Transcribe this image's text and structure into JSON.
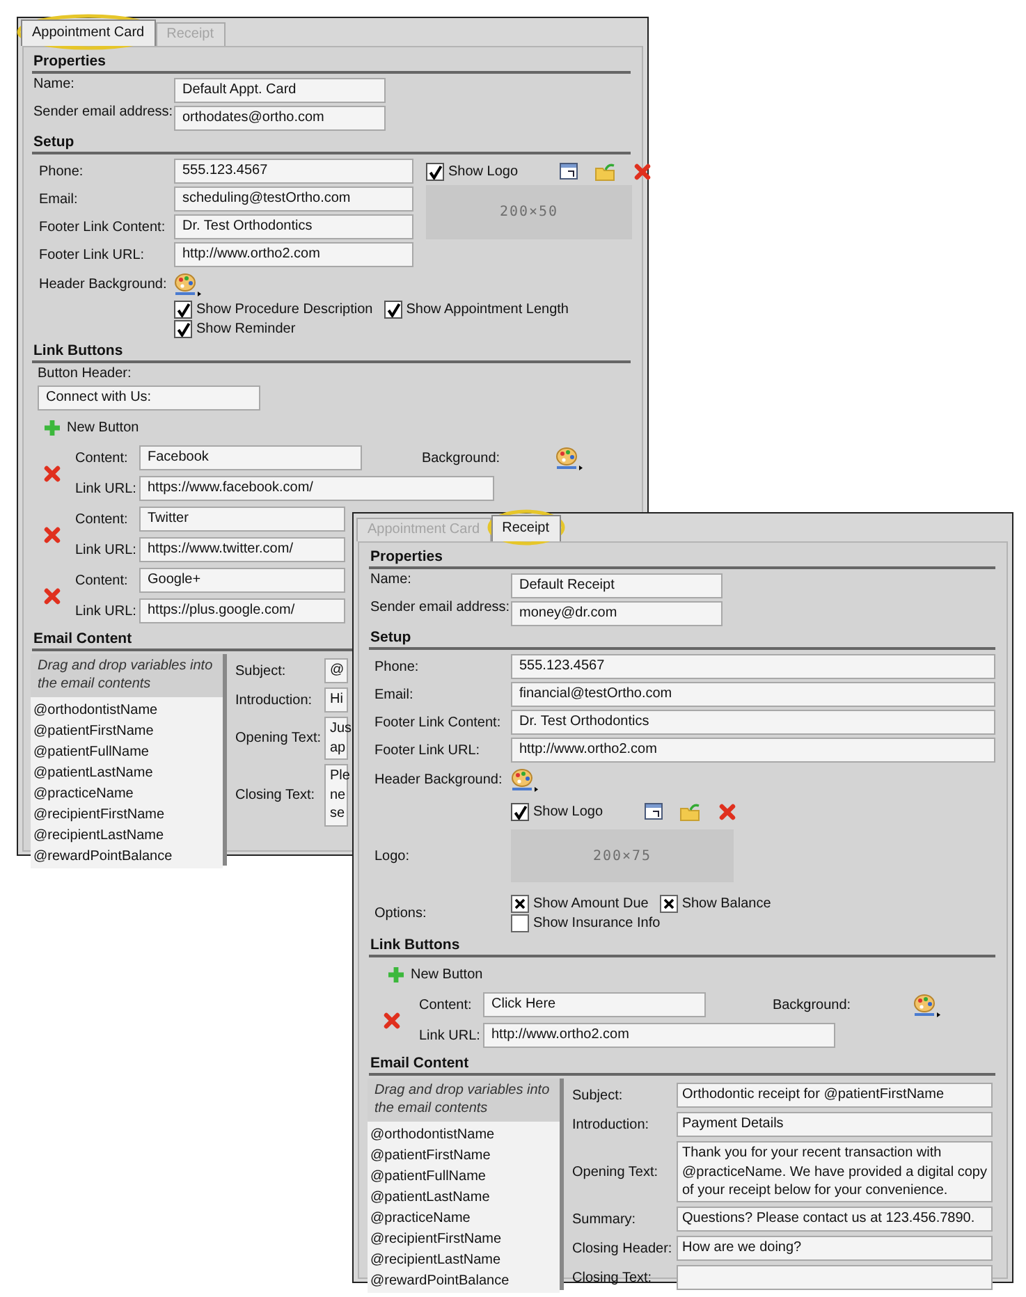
{
  "windows": [
    {
      "tabs": [
        {
          "label": "Appointment Card",
          "selected": true,
          "highlighted": true
        },
        {
          "label": "Receipt",
          "selected": false,
          "highlighted": false
        }
      ],
      "properties": {
        "heading": "Properties",
        "fields": [
          {
            "label": "Name:",
            "value": "Default Appt. Card"
          },
          {
            "label": "Sender email address:",
            "value": "orthodates@ortho.com"
          }
        ]
      },
      "setup": {
        "heading": "Setup",
        "fields": [
          {
            "label": "Phone:",
            "value": "555.123.4567"
          },
          {
            "label": "Email:",
            "value": "scheduling@testOrtho.com"
          },
          {
            "label": "Footer Link Content:",
            "value": "Dr. Test Orthodontics"
          },
          {
            "label": "Footer Link URL:",
            "value": "http://www.ortho2.com"
          }
        ],
        "header_background_label": "Header Background:",
        "logo": {
          "kind": "side",
          "show_label": "Show Logo",
          "checked": true,
          "placeholder": "200×50"
        },
        "options": {
          "items": [
            {
              "label": "Show Procedure Description",
              "checked": true,
              "kind": "tick"
            },
            {
              "label": "Show Appointment Length",
              "checked": true,
              "kind": "tick"
            },
            {
              "label": "Show Reminder",
              "checked": true,
              "kind": "tick"
            }
          ]
        }
      },
      "link_buttons": {
        "heading": "Link Buttons",
        "button_header": {
          "label": "Button Header:",
          "value": "Connect with Us:"
        },
        "new_button": "New Button",
        "buttons": [
          {
            "content_label": "Content:",
            "content": "Facebook",
            "background_label": "Background:",
            "url_label": "Link URL:",
            "url": "https://www.facebook.com/"
          },
          {
            "content_label": "Content:",
            "content": "Twitter",
            "url_label": "Link URL:",
            "url": "https://www.twitter.com/"
          },
          {
            "content_label": "Content:",
            "content": "Google+",
            "url_label": "Link URL:",
            "url": "https://plus.google.com/"
          }
        ]
      },
      "email_content": {
        "heading": "Email Content",
        "hint": "Drag and drop variables into the email contents",
        "variables": [
          "@orthodontistName",
          "@patientFirstName",
          "@patientFullName",
          "@patientLastName",
          "@practiceName",
          "@recipientFirstName",
          "@recipientLastName",
          "@rewardPointBalance"
        ],
        "fields": [
          {
            "label": "Subject:",
            "value": "@"
          },
          {
            "label": "Introduction:",
            "value": "Hi"
          },
          {
            "label": "Opening Text:",
            "value": "Jus\nap"
          },
          {
            "label": "Closing Text:",
            "value": "Ple\nne\nse"
          }
        ]
      }
    },
    {
      "tabs": [
        {
          "label": "Appointment Card",
          "selected": false,
          "highlighted": false
        },
        {
          "label": "Receipt",
          "selected": true,
          "highlighted": true
        }
      ],
      "properties": {
        "heading": "Properties",
        "fields": [
          {
            "label": "Name:",
            "value": "Default Receipt"
          },
          {
            "label": "Sender email address:",
            "value": "money@dr.com"
          }
        ]
      },
      "setup": {
        "heading": "Setup",
        "fields": [
          {
            "label": "Phone:",
            "value": "555.123.4567"
          },
          {
            "label": "Email:",
            "value": "financial@testOrtho.com"
          },
          {
            "label": "Footer Link Content:",
            "value": "Dr. Test Orthodontics"
          },
          {
            "label": "Footer Link URL:",
            "value": "http://www.ortho2.com"
          }
        ],
        "header_background_label": "Header Background:",
        "logo": {
          "kind": "below",
          "label": "Logo:",
          "show_label": "Show Logo",
          "checked": true,
          "placeholder": "200×75"
        },
        "options": {
          "label": "Options:",
          "items": [
            {
              "label": "Show Amount Due",
              "checked": true,
              "kind": "cross"
            },
            {
              "label": "Show Balance",
              "checked": true,
              "kind": "cross"
            },
            {
              "label": "Show Insurance Info",
              "checked": false,
              "kind": "cross"
            }
          ]
        }
      },
      "link_buttons": {
        "heading": "Link Buttons",
        "new_button": "New Button",
        "buttons": [
          {
            "content_label": "Content:",
            "content": "Click Here",
            "background_label": "Background:",
            "url_label": "Link URL:",
            "url": "http://www.ortho2.com"
          }
        ]
      },
      "email_content": {
        "heading": "Email Content",
        "hint": "Drag and drop variables into the email contents",
        "variables": [
          "@orthodontistName",
          "@patientFirstName",
          "@patientFullName",
          "@patientLastName",
          "@practiceName",
          "@recipientFirstName",
          "@recipientLastName",
          "@rewardPointBalance"
        ],
        "fields": [
          {
            "label": "Subject:",
            "value": "Orthodontic receipt for @patientFirstName"
          },
          {
            "label": "Introduction:",
            "value": "Payment Details"
          },
          {
            "label": "Opening Text:",
            "value": "Thank you for your recent transaction with @practiceName.  We have provided a digital copy of your receipt below for your convenience."
          },
          {
            "label": "Summary:",
            "value": "Questions?  Please contact us at 123.456.7890."
          },
          {
            "label": "Closing Header:",
            "value": "How are we doing?"
          },
          {
            "label": "Closing Text:"
          }
        ]
      }
    }
  ]
}
